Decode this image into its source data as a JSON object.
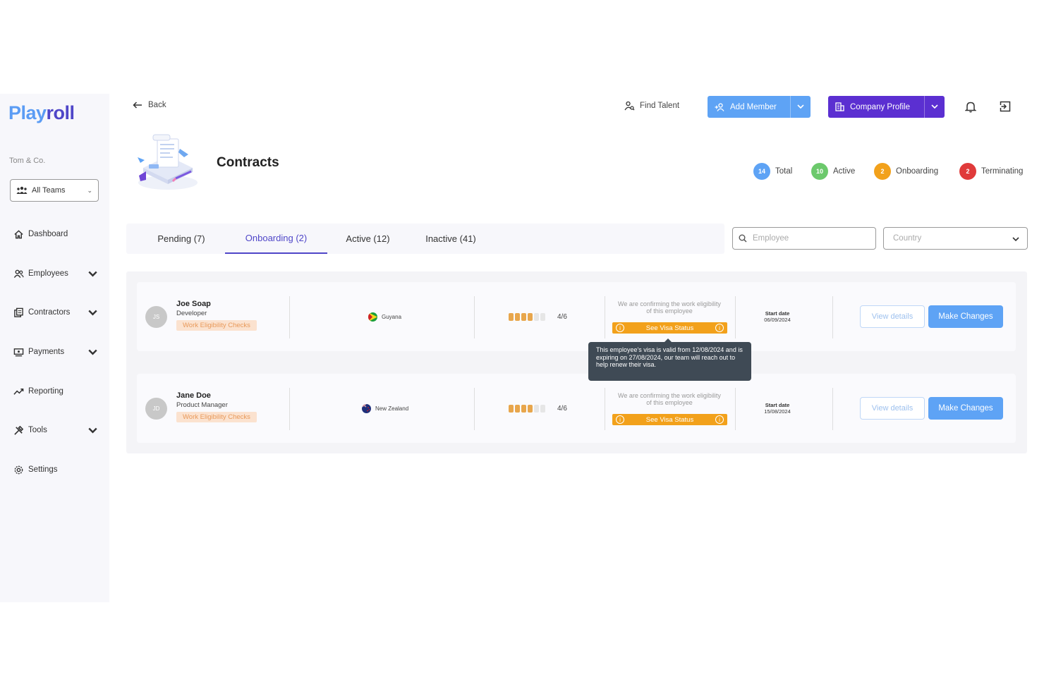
{
  "brand": {
    "part1": "Play",
    "part2": "roll"
  },
  "org_name": "Tom & Co.",
  "team_select": {
    "value": "All Teams"
  },
  "nav": [
    {
      "label": "Dashboard",
      "icon": "home-icon"
    },
    {
      "label": "Employees",
      "icon": "users-icon"
    },
    {
      "label": "Contractors",
      "icon": "documents-icon"
    },
    {
      "label": "Payments",
      "icon": "payment-icon"
    },
    {
      "label": "Reporting",
      "icon": "trend-icon"
    },
    {
      "label": "Tools",
      "icon": "tools-icon"
    },
    {
      "label": "Settings",
      "icon": "gear-icon"
    }
  ],
  "topbar": {
    "back_label": "Back",
    "find_talent_label": "Find Talent",
    "add_member_label": "Add Member",
    "company_profile_label": "Company Profile"
  },
  "page": {
    "title": "Contracts"
  },
  "stats": [
    {
      "count": "14",
      "label": "Total",
      "color": "#5ea3f5"
    },
    {
      "count": "10",
      "label": "Active",
      "color": "#6cc96c"
    },
    {
      "count": "2",
      "label": "Onboarding",
      "color": "#f2a11b"
    },
    {
      "count": "2",
      "label": "Terminating",
      "color": "#e03a3a"
    }
  ],
  "tabs": [
    {
      "label": "Pending (7)"
    },
    {
      "label": "Onboarding (2)",
      "active": true
    },
    {
      "label": "Active (12)"
    },
    {
      "label": "Inactive (41)"
    }
  ],
  "filters": {
    "employee_placeholder": "Employee",
    "country_placeholder": "Country"
  },
  "contracts": [
    {
      "initials": "JS",
      "name": "Joe Soap",
      "role": "Developer",
      "badge": "Work Eligibility Checks",
      "country": "Guyana",
      "progress_done": 4,
      "progress_total": 6,
      "progress_text": "4/6",
      "confirm_text": "We are confirming the work eligibility of this employee",
      "visa_button": "See Visa Status",
      "start_label": "Start date",
      "start_date": "06/09/2024",
      "view_label": "View details",
      "make_label": "Make Changes"
    },
    {
      "initials": "JD",
      "name": "Jane Doe",
      "role": "Product Manager",
      "badge": "Work Eligibility Checks",
      "country": "New Zealand",
      "progress_done": 4,
      "progress_total": 6,
      "progress_text": "4/6",
      "confirm_text": "We are confirming the work eligibility of this employee",
      "visa_button": "See Visa Status",
      "start_label": "Start date",
      "start_date": "15/08/2024",
      "view_label": "View details",
      "make_label": "Make Changes"
    }
  ],
  "tooltip": {
    "text": "This employee's visa is valid from 12/08/2024 and is expiring on 27/08/2024, our team will reach out to help renew their visa."
  }
}
